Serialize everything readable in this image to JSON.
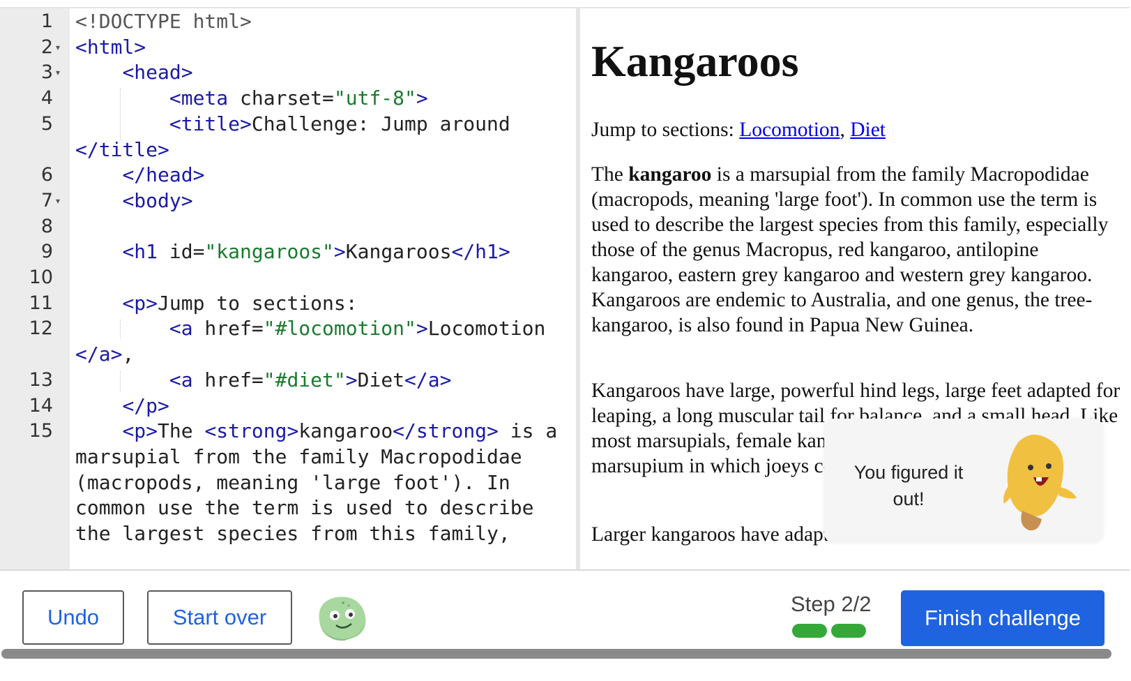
{
  "editor": {
    "lines": [
      {
        "n": "1",
        "fold": false,
        "parts": [
          {
            "c": "doc",
            "t": "<!DOCTYPE html>"
          }
        ]
      },
      {
        "n": "2",
        "fold": true,
        "parts": [
          {
            "c": "tag",
            "t": "<html>"
          }
        ]
      },
      {
        "n": "3",
        "fold": true,
        "parts": [
          {
            "c": "",
            "t": "    "
          },
          {
            "c": "tag",
            "t": "<head>"
          }
        ]
      },
      {
        "n": "4",
        "fold": false,
        "parts": [
          {
            "c": "",
            "t": "        "
          },
          {
            "c": "tag",
            "t": "<meta"
          },
          {
            "c": "attr",
            "t": " charset="
          },
          {
            "c": "str",
            "t": "\"utf-8\""
          },
          {
            "c": "tag",
            "t": ">"
          }
        ]
      },
      {
        "n": "5",
        "fold": false,
        "parts": [
          {
            "c": "",
            "t": "        "
          },
          {
            "c": "tag",
            "t": "<title>"
          },
          {
            "c": "",
            "t": "Challenge: Jump around"
          }
        ]
      },
      {
        "n": "",
        "fold": false,
        "parts": [
          {
            "c": "tag",
            "t": "</title>"
          }
        ]
      },
      {
        "n": "6",
        "fold": false,
        "parts": [
          {
            "c": "",
            "t": "    "
          },
          {
            "c": "tag",
            "t": "</head>"
          }
        ]
      },
      {
        "n": "7",
        "fold": true,
        "parts": [
          {
            "c": "",
            "t": "    "
          },
          {
            "c": "tag",
            "t": "<body>"
          }
        ]
      },
      {
        "n": "8",
        "fold": false,
        "parts": [
          {
            "c": "",
            "t": ""
          }
        ]
      },
      {
        "n": "9",
        "fold": false,
        "parts": [
          {
            "c": "",
            "t": "    "
          },
          {
            "c": "tag",
            "t": "<h1"
          },
          {
            "c": "attr",
            "t": " id="
          },
          {
            "c": "str",
            "t": "\"kangaroos\""
          },
          {
            "c": "tag",
            "t": ">"
          },
          {
            "c": "",
            "t": "Kangaroos"
          },
          {
            "c": "tag",
            "t": "</h1>"
          }
        ]
      },
      {
        "n": "10",
        "fold": false,
        "parts": [
          {
            "c": "",
            "t": ""
          }
        ]
      },
      {
        "n": "11",
        "fold": false,
        "parts": [
          {
            "c": "",
            "t": "    "
          },
          {
            "c": "tag",
            "t": "<p>"
          },
          {
            "c": "",
            "t": "Jump to sections:"
          }
        ]
      },
      {
        "n": "12",
        "fold": false,
        "parts": [
          {
            "c": "",
            "t": "        "
          },
          {
            "c": "tag",
            "t": "<a"
          },
          {
            "c": "attr",
            "t": " href="
          },
          {
            "c": "str",
            "t": "\"#locomotion\""
          },
          {
            "c": "tag",
            "t": ">"
          },
          {
            "c": "",
            "t": "Locomotion"
          }
        ]
      },
      {
        "n": "",
        "fold": false,
        "parts": [
          {
            "c": "tag",
            "t": "</a>"
          },
          {
            "c": "",
            "t": ","
          }
        ]
      },
      {
        "n": "13",
        "fold": false,
        "parts": [
          {
            "c": "",
            "t": "        "
          },
          {
            "c": "tag",
            "t": "<a"
          },
          {
            "c": "attr",
            "t": " href="
          },
          {
            "c": "str",
            "t": "\"#diet\""
          },
          {
            "c": "tag",
            "t": ">"
          },
          {
            "c": "",
            "t": "Diet"
          },
          {
            "c": "tag",
            "t": "</a>"
          }
        ]
      },
      {
        "n": "14",
        "fold": false,
        "parts": [
          {
            "c": "",
            "t": "    "
          },
          {
            "c": "tag",
            "t": "</p>"
          }
        ]
      },
      {
        "n": "15",
        "fold": false,
        "parts": [
          {
            "c": "",
            "t": "    "
          },
          {
            "c": "tag",
            "t": "<p>"
          },
          {
            "c": "",
            "t": "The "
          },
          {
            "c": "tag",
            "t": "<strong>"
          },
          {
            "c": "",
            "t": "kangaroo"
          },
          {
            "c": "tag",
            "t": "</strong>"
          },
          {
            "c": "",
            "t": " is a"
          }
        ]
      },
      {
        "n": "",
        "fold": false,
        "parts": [
          {
            "c": "",
            "t": "marsupial from the family Macropodidae"
          }
        ]
      },
      {
        "n": "",
        "fold": false,
        "parts": [
          {
            "c": "",
            "t": "(macropods, meaning 'large foot'). In"
          }
        ]
      },
      {
        "n": "",
        "fold": false,
        "parts": [
          {
            "c": "",
            "t": "common use the term is used to describe"
          }
        ]
      },
      {
        "n": "",
        "fold": false,
        "parts": [
          {
            "c": "",
            "t": "the largest species from this family,"
          }
        ]
      }
    ]
  },
  "preview": {
    "heading": "Kangaroos",
    "jump_prefix": "Jump to sections: ",
    "link_locomotion": "Locomotion",
    "link_sep": ",",
    "link_diet": "Diet",
    "p1_the": "The ",
    "p1_strong": "kangaroo",
    "p1_rest": " is a marsupial from the family Macropodidae (macropods, meaning 'large foot'). In common use the term is used to describe the largest species from this family, especially those of the genus Macropus, red kangaroo, antilopine kangaroo, eastern grey kangaroo and western grey kangaroo. Kangaroos are endemic to Australia, and one genus, the tree-kangaroo, is also found in Papua New Guinea.",
    "p2": "Kangaroos have large, powerful hind legs, large feet adapted for leaping, a long muscular tail for balance, and a small head. Like most marsupials, female kangaroos have a pouch called a marsupium in which joeys complete postnatal development.",
    "p3": "Larger kangaroos have adapted much better than smaller"
  },
  "toast": {
    "message": "You figured it out!"
  },
  "bottom": {
    "undo_label": "Undo",
    "start_over_label": "Start over",
    "step_label": "Step 2/2",
    "progress_completed": 2,
    "progress_total": 2,
    "finish_label": "Finish challenge"
  },
  "colors": {
    "accent": "#1f63e0",
    "progress": "#35a83a",
    "link": "#0000ee"
  }
}
